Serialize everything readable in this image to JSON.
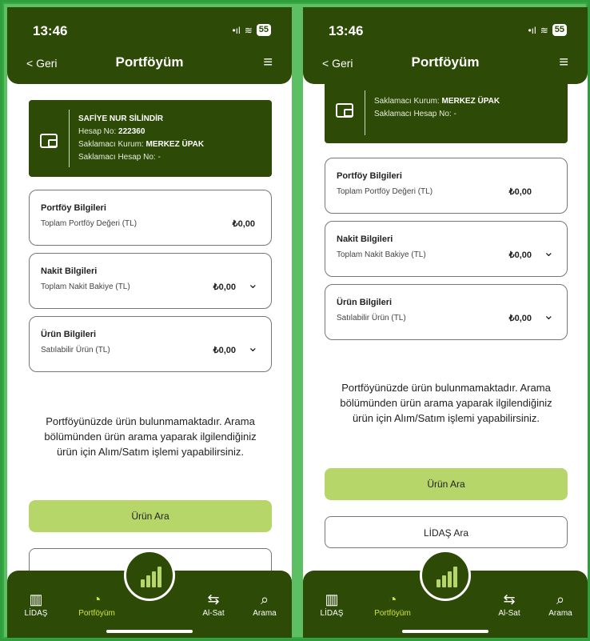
{
  "status": {
    "time": "13:46",
    "signal": "•ıl",
    "wifi": "≋",
    "battery": "55"
  },
  "nav": {
    "back": "< Geri",
    "title": "Portföyüm",
    "menu": "≡"
  },
  "account": {
    "name": "SAFİYE NUR SİLİNDİR",
    "account_no_label": "Hesap No:",
    "account_no": "222360",
    "custodian_label": "Saklamacı Kurum:",
    "custodian": "MERKEZ ÜPAK",
    "custody_account_label": "Saklamacı Hesap No:",
    "custody_account": "-"
  },
  "cards": [
    {
      "title": "Portföy Bilgileri",
      "label": "Toplam Portföy Değeri (TL)",
      "value": "₺0,00"
    },
    {
      "title": "Nakit Bilgileri",
      "label": "Toplam Nakit Bakiye (TL)",
      "value": "₺0,00"
    },
    {
      "title": "Ürün Bilgileri",
      "label": "Satılabilir Ürün (TL)",
      "value": "₺0,00"
    }
  ],
  "message": "Portföyünüzde ürün bulunmamaktadır. Arama bölümünden ürün arama yaparak ilgilendiğiniz ürün için Alım/Satım işlemi yapabilirsiniz.",
  "buttons": {
    "search_product": "Ürün Ara",
    "call_lidas": "LİDAŞ Ara"
  },
  "tabs": [
    {
      "label": "LİDAŞ",
      "icon": "building-icon"
    },
    {
      "label": "Portföyüm",
      "icon": "pie-chart-icon"
    },
    {
      "label": "Al-Sat",
      "icon": "exchange-icon"
    },
    {
      "label": "Arama",
      "icon": "search-icon"
    }
  ],
  "colors": {
    "primary": "#2d4a06",
    "accent": "#b6d66a",
    "active_tab": "#d2e63a"
  }
}
